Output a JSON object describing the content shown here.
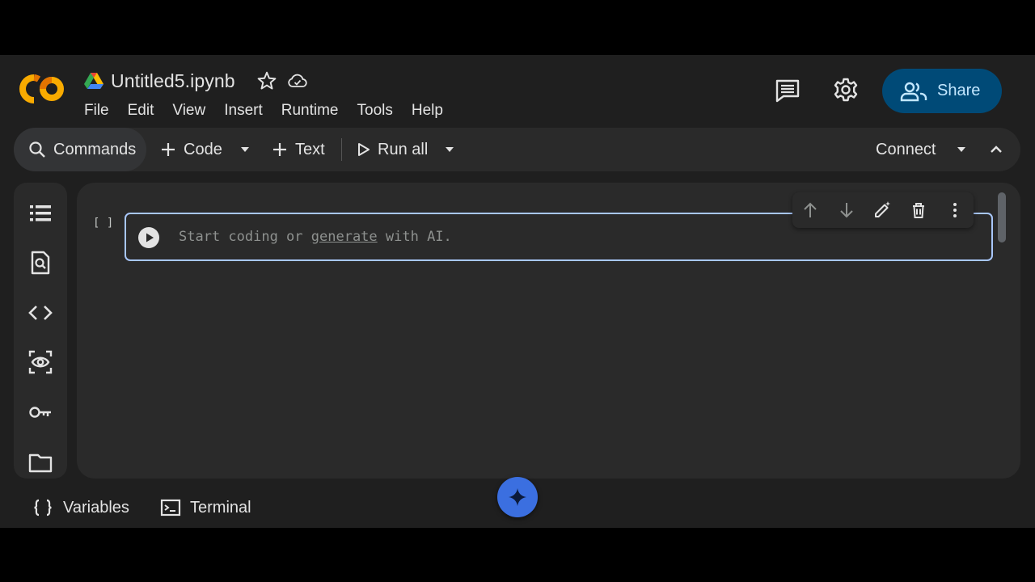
{
  "app": {
    "logo_text": "CO",
    "doc_title": "Untitled5.ipynb",
    "menu": [
      "File",
      "Edit",
      "View",
      "Insert",
      "Runtime",
      "Tools",
      "Help"
    ]
  },
  "header": {
    "share_label": "Share"
  },
  "toolbar": {
    "commands_label": "Commands",
    "code_label": "Code",
    "text_label": "Text",
    "run_all_label": "Run all",
    "connect_label": "Connect"
  },
  "sidebar": {
    "icons": [
      "table-of-contents-icon",
      "find-icon",
      "code-snippets-icon",
      "variables-inspector-icon",
      "secrets-key-icon",
      "files-folder-icon"
    ]
  },
  "cell": {
    "execution_count": "[ ]",
    "placeholder_before": "Start coding or ",
    "placeholder_link": "generate",
    "placeholder_after": " with AI."
  },
  "bottom_bar": {
    "variables_label": "Variables",
    "terminal_label": "Terminal"
  },
  "colors": {
    "background": "#1f1f1f",
    "panel": "#2a2a2a",
    "share_button": "#004a77",
    "share_text": "#c2e7ff",
    "cell_border": "#a8c7fa",
    "gemini": "#3b6fe0",
    "logo_orange": "#f9ab00",
    "logo_dark_orange": "#e37400"
  }
}
